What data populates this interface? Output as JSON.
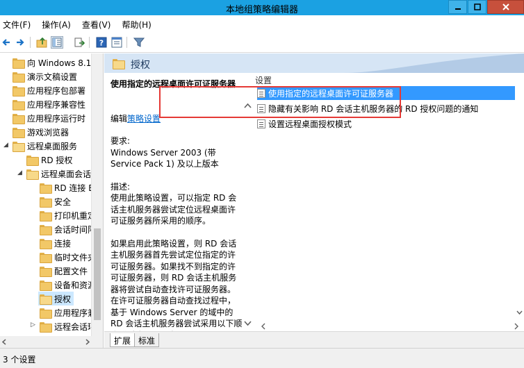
{
  "window": {
    "title": "本地组策略编辑器"
  },
  "menu": [
    {
      "label": "文件(F)"
    },
    {
      "label": "操作(A)"
    },
    {
      "label": "查看(V)"
    },
    {
      "label": "帮助(H)"
    }
  ],
  "tree": {
    "items": [
      {
        "label": "向 Windows 8.1"
      },
      {
        "label": "演示文稿设置"
      },
      {
        "label": "应用程序包部署"
      },
      {
        "label": "应用程序兼容性"
      },
      {
        "label": "应用程序运行时"
      },
      {
        "label": "游戏浏览器"
      },
      {
        "label": "远程桌面服务"
      },
      {
        "label": "RD 授权"
      },
      {
        "label": "远程桌面会话"
      },
      {
        "label": "RD 连接 B"
      },
      {
        "label": "安全"
      },
      {
        "label": "打印机重定"
      },
      {
        "label": "会话时间限"
      },
      {
        "label": "连接"
      },
      {
        "label": "临时文件夹"
      },
      {
        "label": "配置文件"
      },
      {
        "label": "设备和资源"
      },
      {
        "label": "授权"
      },
      {
        "label": "应用程序兼"
      },
      {
        "label": "远程会话环"
      }
    ]
  },
  "category": {
    "title": "授权"
  },
  "description": {
    "title": "使用指定的远程桌面许可证服务器",
    "edit_prefix": "编辑",
    "edit_link": "策略设置",
    "requirements_label": "要求:",
    "requirements": "Windows Server 2003 (带 Service Pack 1) 及以上版本",
    "description_label": "描述:",
    "para1": "使用此策略设置，可以指定 RD 会话主机服务器尝试定位远程桌面许可证服务器所采用的顺序。",
    "para2": "如果启用此策略设置，则 RD 会话主机服务器首先尝试定位指定的许可证服务器。如果找不到指定的许可证服务器，则 RD 会话主机服务器将尝试自动查找许可证服务器。在许可证服务器自动查找过程中，基于 Windows Server 的域中的 RD 会话主机服务器尝试采用以下顺序联系许可证服务器"
  },
  "list": {
    "header": "设置",
    "items": [
      {
        "label": "使用指定的远程桌面许可证服务器"
      },
      {
        "label": "隐藏有关影响 RD 会话主机服务器的 RD 授权问题的通知"
      },
      {
        "label": "设置远程桌面授权模式"
      }
    ]
  },
  "tabs": [
    {
      "label": "扩展"
    },
    {
      "label": "标准"
    }
  ],
  "status": {
    "text": "3 个设置"
  }
}
